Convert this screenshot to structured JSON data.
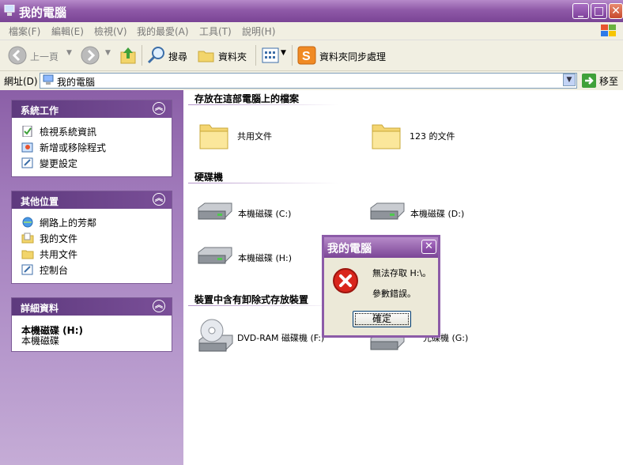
{
  "window": {
    "title": "我的電腦"
  },
  "menu": [
    "檔案(F)",
    "編輯(E)",
    "檢視(V)",
    "我的最愛(A)",
    "工具(T)",
    "說明(H)"
  ],
  "toolbar": {
    "back": "上一頁",
    "search": "搜尋",
    "folders": "資料夾",
    "sync": "資料夾同步處理"
  },
  "address": {
    "label": "網址(D)",
    "value": "我的電腦",
    "go": "移至"
  },
  "panels": {
    "system_tasks": {
      "title": "系統工作",
      "items": [
        "檢視系統資訊",
        "新增或移除程式",
        "變更設定"
      ]
    },
    "other_places": {
      "title": "其他位置",
      "items": [
        "網路上的芳鄰",
        "我的文件",
        "共用文件",
        "控制台"
      ]
    },
    "details": {
      "title": "詳細資料",
      "name": "本機磁碟 (H:)",
      "type": "本機磁碟"
    }
  },
  "sections": {
    "files": {
      "title": "存放在這部電腦上的檔案",
      "items": [
        "共用文件",
        "123 的文件"
      ]
    },
    "hdd": {
      "title": "硬碟機",
      "items": [
        "本機磁碟 (C:)",
        "本機磁碟 (D:)",
        "本機磁碟 (H:)"
      ]
    },
    "removable": {
      "title": "裝置中含有卸除式存放裝置",
      "items": [
        "DVD-RAM 磁碟機 (F:)",
        "光碟機 (G:)"
      ]
    }
  },
  "dialog": {
    "title": "我的電腦",
    "line1": "無法存取 H:\\。",
    "line2": "參數錯誤。",
    "ok": "確定"
  }
}
